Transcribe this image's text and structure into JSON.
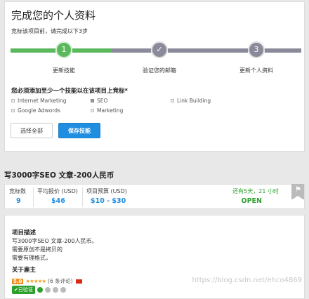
{
  "profile": {
    "title": "完成您的个人资料",
    "subtitle": "竞标该项目前，请完成以下3步",
    "steps": [
      {
        "number": "1",
        "label": "更新技能",
        "state": "current"
      },
      {
        "number": "✓",
        "label": "验证您的邮箱",
        "state": "done"
      },
      {
        "number": "3",
        "label": "更新个人资料",
        "state": "pending"
      }
    ],
    "prompt": "您必须添加至少一个技能以在该项目上竞标*",
    "skills": [
      {
        "label": "Internet Marketing",
        "checked": false
      },
      {
        "label": "SEO",
        "checked": true
      },
      {
        "label": "Link Building",
        "checked": false
      },
      {
        "label": "Google Adwords",
        "checked": false
      },
      {
        "label": "Marketing",
        "checked": false
      }
    ],
    "select_all_label": "选择全部",
    "save_label": "保存技能"
  },
  "project": {
    "title": "写3000字SEO 文章-200人民币"
  },
  "stats": {
    "bids_label": "竞标数",
    "bids_value": "9",
    "avg_label": "平均报价 (USD)",
    "avg_value": "$46",
    "budget_label": "项目预算 (USD)",
    "budget_value": "$10 - $30",
    "time_left": "还有5天，21 小时",
    "status": "OPEN"
  },
  "description": {
    "heading": "项目描述",
    "lines": [
      "写3000字SEO 文章-200人民币。",
      "需要原创不是拷贝的",
      "需要有理格式，"
    ],
    "employer_heading": "关于雇主",
    "rating": "5.0",
    "stars": "★★★★★",
    "reviews": "(6 条评论)",
    "verified_label": "已验证"
  },
  "colors": {
    "progress_green": "#5cb85c",
    "progress_gray": "#8a8a9a",
    "primary_blue": "#1f8ee0",
    "open_green": "#2ca02c"
  },
  "watermark": "https://blog.csdn.net/ehco4869"
}
